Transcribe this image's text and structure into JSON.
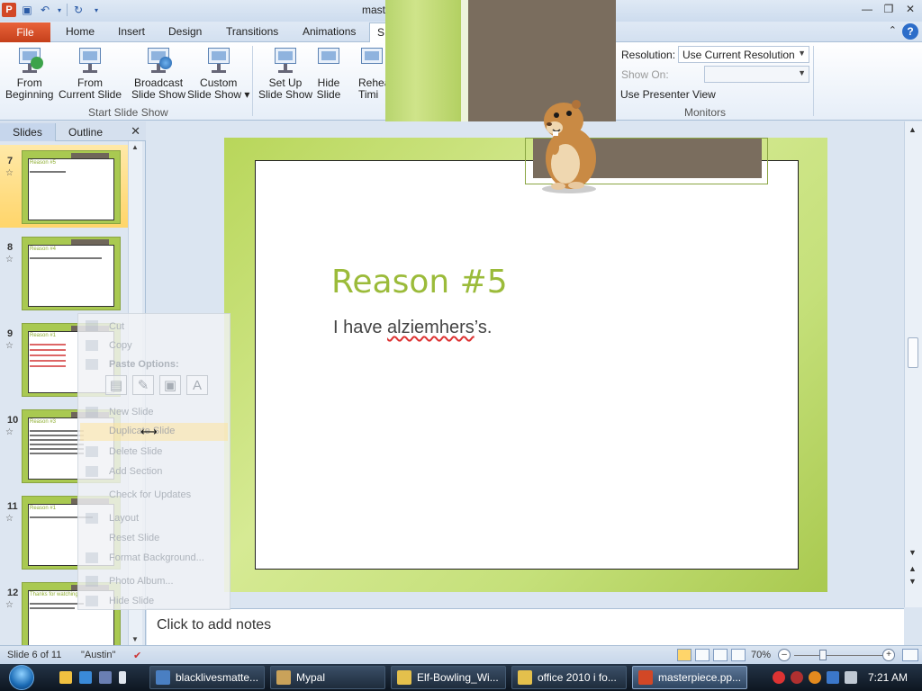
{
  "window": {
    "title": "mast",
    "app_logo": "P"
  },
  "tabs": {
    "file": "File",
    "items": [
      "Home",
      "Insert",
      "Design",
      "Transitions",
      "Animations",
      "S"
    ]
  },
  "ribbon": {
    "start_group": {
      "from_beginning": [
        "From",
        "Beginning"
      ],
      "from_current": [
        "From",
        "Current Slide"
      ],
      "broadcast": [
        "Broadcast",
        "Slide Show"
      ],
      "custom": [
        "Custom",
        "Slide Show ▾"
      ],
      "label": "Start Slide Show"
    },
    "setup_group": {
      "setup": [
        "Set Up",
        "Slide Show"
      ],
      "hide": [
        "Hide",
        "Slide"
      ],
      "rehearse": [
        "Rehea",
        "Timi"
      ]
    },
    "monitors": {
      "resolution_label": "Resolution:",
      "resolution_value": "Use Current Resolution",
      "show_on_label": "Show On:",
      "presenter_view": "Use Presenter View",
      "label": "Monitors"
    }
  },
  "left_pane": {
    "tab_slides": "Slides",
    "tab_outline": "Outline",
    "slides": [
      {
        "num": "7",
        "title": "Reason #5",
        "selected": true
      },
      {
        "num": "8",
        "title": "Reason #4",
        "selected": false
      },
      {
        "num": "9",
        "title": "Reason #1",
        "selected": false
      },
      {
        "num": "10",
        "title": "Reason #3",
        "selected": false
      },
      {
        "num": "11",
        "title": "Reason #1",
        "selected": false
      },
      {
        "num": "12",
        "title": "Thanks for watching",
        "selected": false
      }
    ]
  },
  "context_menu": {
    "cut": "Cut",
    "copy": "Copy",
    "paste_options": "Paste Options:",
    "new_slide": "New Slide",
    "duplicate_slide": "Duplicate Slide",
    "delete_slide": "Delete Slide",
    "add_section": "Add Section",
    "check_updates": "Check for Updates",
    "layout": "Layout",
    "reset_slide": "Reset Slide",
    "format_background": "Format Background...",
    "photo_album": "Photo Album...",
    "hide_slide": "Hide Slide"
  },
  "slide": {
    "title": "Reason #5",
    "body_pre": "I have ",
    "body_err": "alziemhers",
    "body_post": "’s."
  },
  "notes": {
    "placeholder": "Click to add notes"
  },
  "status": {
    "slide_info": "Slide 6 of 11",
    "theme": "\"Austin\"",
    "zoom": "70%",
    "zoom_fraction": 0.35
  },
  "taskbar": {
    "buttons": [
      {
        "label": "blacklivesmatte...",
        "active": false
      },
      {
        "label": "Mypal",
        "active": false
      },
      {
        "label": "Elf-Bowling_Wi...",
        "active": false
      },
      {
        "label": "office 2010 i fo...",
        "active": false
      },
      {
        "label": "masterpiece.pp...",
        "active": true
      }
    ],
    "clock": "7:21 AM"
  },
  "colors": {
    "accent_file": "#d24726",
    "slide_green": "#9bbb3a",
    "brown": "#7a6d5e"
  }
}
